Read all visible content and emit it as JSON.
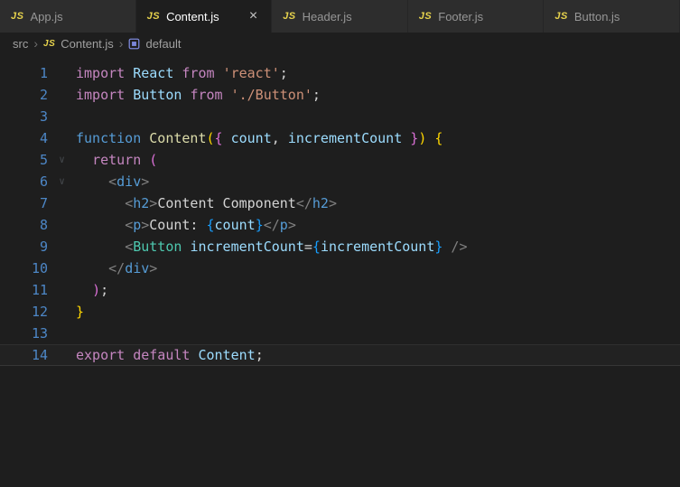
{
  "colors": {
    "keyword": "#C586C0",
    "keyword2": "#569CD6",
    "func": "#DCDCAA",
    "var": "#9CDCFE",
    "string": "#CE9178",
    "plain": "#D4D4D4",
    "punct": "#808080",
    "tag": "#569CD6",
    "component": "#4EC9B0",
    "b1": "#FFD700",
    "b2": "#DA70D6",
    "b3": "#179FFF",
    "line_number": "#4d87c7",
    "js_badge": "#e8d44d",
    "accent_module_icon": "#7b87d8"
  },
  "icons": {
    "js_badge": "JS",
    "close": "×",
    "chevron": "›",
    "fold": "∨"
  },
  "tabs": [
    {
      "label": "App.js",
      "active": false
    },
    {
      "label": "Content.js",
      "active": true
    },
    {
      "label": "Header.js",
      "active": false
    },
    {
      "label": "Footer.js",
      "active": false
    },
    {
      "label": "Button.js",
      "active": false
    }
  ],
  "breadcrumb": {
    "path": "src",
    "file": "Content.js",
    "symbol": "default"
  },
  "editor": {
    "lines": [
      {
        "num": 1,
        "tokens": [
          [
            "keyword",
            "import "
          ],
          [
            "var",
            "React "
          ],
          [
            "keyword",
            "from "
          ],
          [
            "string",
            "'react'"
          ],
          [
            "plain",
            ";"
          ]
        ]
      },
      {
        "num": 2,
        "tokens": [
          [
            "keyword",
            "import "
          ],
          [
            "var",
            "Button "
          ],
          [
            "keyword",
            "from "
          ],
          [
            "string",
            "'./Button'"
          ],
          [
            "plain",
            ";"
          ]
        ]
      },
      {
        "num": 3,
        "tokens": []
      },
      {
        "num": 4,
        "tokens": [
          [
            "keyword2",
            "function "
          ],
          [
            "func",
            "Content"
          ],
          [
            "b1",
            "("
          ],
          [
            "b2",
            "{"
          ],
          [
            "var",
            " count"
          ],
          [
            "plain",
            ", "
          ],
          [
            "var",
            "incrementCount "
          ],
          [
            "b2",
            "}"
          ],
          [
            "b1",
            ")"
          ],
          [
            "plain",
            " "
          ],
          [
            "b1",
            "{"
          ]
        ]
      },
      {
        "num": 5,
        "fold": true,
        "tokens": [
          [
            "plain",
            "  "
          ],
          [
            "keyword",
            "return "
          ],
          [
            "b2",
            "("
          ]
        ]
      },
      {
        "num": 6,
        "fold": true,
        "tokens": [
          [
            "plain",
            "    "
          ],
          [
            "punct",
            "<"
          ],
          [
            "tag",
            "div"
          ],
          [
            "punct",
            ">"
          ]
        ]
      },
      {
        "num": 7,
        "tokens": [
          [
            "plain",
            "      "
          ],
          [
            "punct",
            "<"
          ],
          [
            "tag",
            "h2"
          ],
          [
            "punct",
            ">"
          ],
          [
            "plain",
            "Content Component"
          ],
          [
            "punct",
            "</"
          ],
          [
            "tag",
            "h2"
          ],
          [
            "punct",
            ">"
          ]
        ]
      },
      {
        "num": 8,
        "tokens": [
          [
            "plain",
            "      "
          ],
          [
            "punct",
            "<"
          ],
          [
            "tag",
            "p"
          ],
          [
            "punct",
            ">"
          ],
          [
            "plain",
            "Count: "
          ],
          [
            "b3",
            "{"
          ],
          [
            "var",
            "count"
          ],
          [
            "b3",
            "}"
          ],
          [
            "punct",
            "</"
          ],
          [
            "tag",
            "p"
          ],
          [
            "punct",
            ">"
          ]
        ]
      },
      {
        "num": 9,
        "tokens": [
          [
            "plain",
            "      "
          ],
          [
            "punct",
            "<"
          ],
          [
            "component",
            "Button "
          ],
          [
            "var",
            "incrementCount"
          ],
          [
            "plain",
            "="
          ],
          [
            "b3",
            "{"
          ],
          [
            "var",
            "incrementCount"
          ],
          [
            "b3",
            "}"
          ],
          [
            "punct",
            " />"
          ]
        ]
      },
      {
        "num": 10,
        "tokens": [
          [
            "plain",
            "    "
          ],
          [
            "punct",
            "</"
          ],
          [
            "tag",
            "div"
          ],
          [
            "punct",
            ">"
          ]
        ]
      },
      {
        "num": 11,
        "tokens": [
          [
            "plain",
            "  "
          ],
          [
            "b2",
            ")"
          ],
          [
            "plain",
            ";"
          ]
        ]
      },
      {
        "num": 12,
        "tokens": [
          [
            "b1",
            "}"
          ]
        ]
      },
      {
        "num": 13,
        "tokens": []
      },
      {
        "num": 14,
        "current": true,
        "tokens": [
          [
            "keyword",
            "export "
          ],
          [
            "keyword",
            "default "
          ],
          [
            "var",
            "Content"
          ],
          [
            "plain",
            ";"
          ]
        ]
      }
    ]
  }
}
